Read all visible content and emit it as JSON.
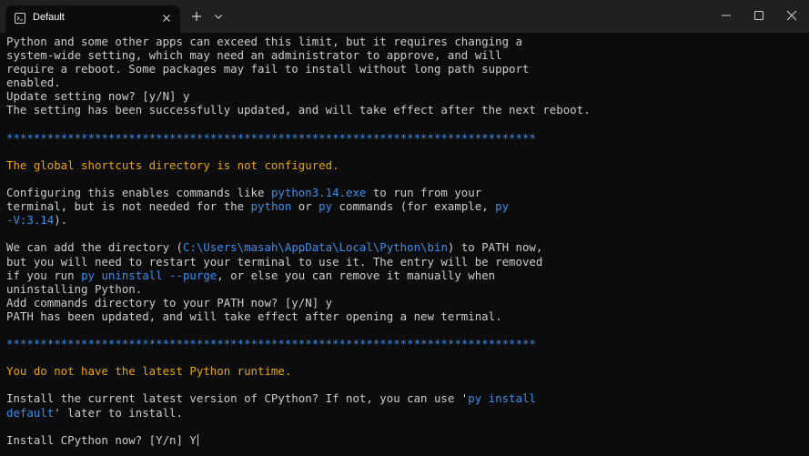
{
  "window": {
    "tab_title": "Default",
    "icons": {
      "tab_icon": "terminal-icon",
      "tab_close": "close-icon",
      "new_tab": "plus-icon",
      "dropdown": "chevron-down-icon",
      "minimize": "minimize-icon",
      "maximize": "maximize-icon",
      "close": "close-icon"
    }
  },
  "colors": {
    "text": "#cccccc",
    "blue": "#3b8eea",
    "yellow": "#e5a50a",
    "background": "#0c0c0c",
    "titlebar": "#202020"
  },
  "terminal": {
    "lines": [
      {
        "segments": [
          {
            "text": "Python and some other apps can exceed this limit, but it requires changing a",
            "color": "default"
          }
        ]
      },
      {
        "segments": [
          {
            "text": "system-wide setting, which may need an administrator to approve, and will",
            "color": "default"
          }
        ]
      },
      {
        "segments": [
          {
            "text": "require a reboot. Some packages may fail to install without long path support",
            "color": "default"
          }
        ]
      },
      {
        "segments": [
          {
            "text": "enabled.",
            "color": "default"
          }
        ]
      },
      {
        "segments": [
          {
            "text": "Update setting now? [y/N] y",
            "color": "default"
          }
        ]
      },
      {
        "segments": [
          {
            "text": "The setting has been successfully updated, and will take effect after the next reboot.",
            "color": "default"
          }
        ]
      },
      {
        "segments": []
      },
      {
        "segments": [
          {
            "text": "******************************************************************************",
            "color": "blue"
          }
        ]
      },
      {
        "segments": []
      },
      {
        "segments": [
          {
            "text": "The global shortcuts directory is not configured.",
            "color": "yellow"
          }
        ]
      },
      {
        "segments": []
      },
      {
        "segments": [
          {
            "text": "Configuring this enables commands like ",
            "color": "default"
          },
          {
            "text": "python3.14.exe",
            "color": "blue"
          },
          {
            "text": " to run from your",
            "color": "default"
          }
        ]
      },
      {
        "segments": [
          {
            "text": "terminal, but is not needed for the ",
            "color": "default"
          },
          {
            "text": "python",
            "color": "blue"
          },
          {
            "text": " or ",
            "color": "default"
          },
          {
            "text": "py",
            "color": "blue"
          },
          {
            "text": " commands (for example, ",
            "color": "default"
          },
          {
            "text": "py",
            "color": "blue"
          }
        ]
      },
      {
        "segments": [
          {
            "text": "-V:3.14",
            "color": "blue"
          },
          {
            "text": ").",
            "color": "default"
          }
        ]
      },
      {
        "segments": []
      },
      {
        "segments": [
          {
            "text": "We can add the directory (",
            "color": "default"
          },
          {
            "text": "C:\\Users\\masah\\AppData\\Local\\Python\\bin",
            "color": "blue"
          },
          {
            "text": ") to PATH now,",
            "color": "default"
          }
        ]
      },
      {
        "segments": [
          {
            "text": "but you will need to restart your terminal to use it. The entry will be removed",
            "color": "default"
          }
        ]
      },
      {
        "segments": [
          {
            "text": "if you run ",
            "color": "default"
          },
          {
            "text": "py uninstall --purge",
            "color": "blue"
          },
          {
            "text": ", or else you can remove it manually when",
            "color": "default"
          }
        ]
      },
      {
        "segments": [
          {
            "text": "uninstalling Python.",
            "color": "default"
          }
        ]
      },
      {
        "segments": [
          {
            "text": "Add commands directory to your PATH now? [y/N] y",
            "color": "default"
          }
        ]
      },
      {
        "segments": [
          {
            "text": "PATH has been updated, and will take effect after opening a new terminal.",
            "color": "default"
          }
        ]
      },
      {
        "segments": []
      },
      {
        "segments": [
          {
            "text": "******************************************************************************",
            "color": "blue"
          }
        ]
      },
      {
        "segments": []
      },
      {
        "segments": [
          {
            "text": "You do not have the latest Python runtime.",
            "color": "yellow"
          }
        ]
      },
      {
        "segments": []
      },
      {
        "segments": [
          {
            "text": "Install the current latest version of CPython? If not, you can use '",
            "color": "default"
          },
          {
            "text": "py install",
            "color": "blue"
          }
        ]
      },
      {
        "segments": [
          {
            "text": "default",
            "color": "blue"
          },
          {
            "text": "' later to install.",
            "color": "default"
          }
        ]
      },
      {
        "segments": []
      },
      {
        "segments": [
          {
            "text": "Install CPython now? [Y/n] Y",
            "color": "default"
          }
        ],
        "cursor": true
      }
    ]
  }
}
